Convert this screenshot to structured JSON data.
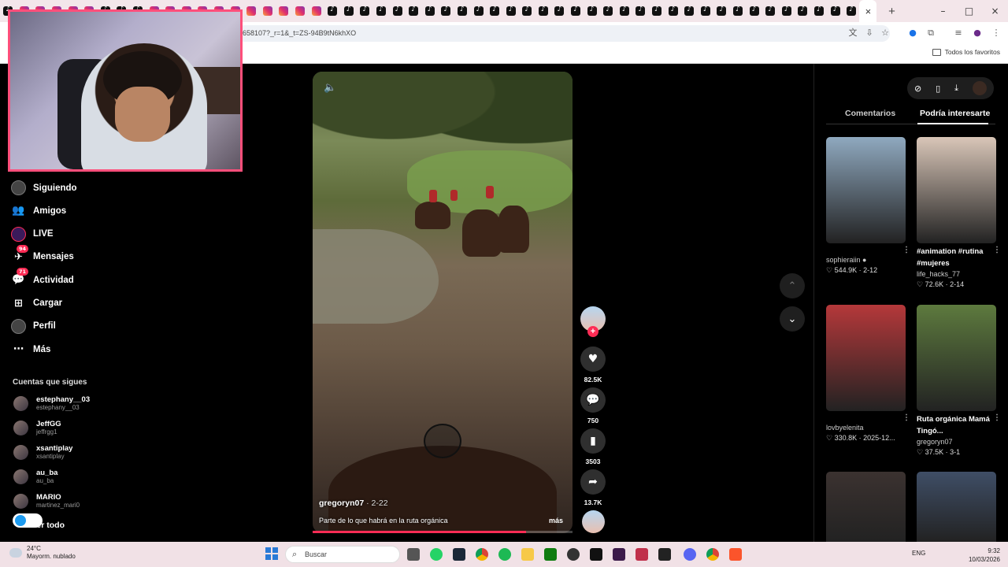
{
  "browser": {
    "url_fragment": "658107?_r=1&_t=ZS-94B9tN6khXO",
    "bookmarks_label": "Todos los favoritos",
    "new_tab": "+",
    "window_controls": [
      "–",
      "□",
      "×"
    ]
  },
  "sidebar": {
    "items": [
      {
        "label": "Siguiendo",
        "icon": "following-avatar-icon",
        "badge": ""
      },
      {
        "label": "Amigos",
        "icon": "friends-icon",
        "badge": ""
      },
      {
        "label": "LIVE",
        "icon": "live-icon",
        "badge": ""
      },
      {
        "label": "Mensajes",
        "icon": "messages-icon",
        "badge": "94"
      },
      {
        "label": "Actividad",
        "icon": "activity-icon",
        "badge": "71"
      },
      {
        "label": "Cargar",
        "icon": "upload-icon",
        "badge": ""
      },
      {
        "label": "Perfil",
        "icon": "profile-avatar-icon",
        "badge": ""
      },
      {
        "label": "Más",
        "icon": "more-icon",
        "badge": ""
      }
    ],
    "following_heading": "Cuentas que sigues",
    "accounts": [
      {
        "name": "estephany__03",
        "handle": "estephany__03"
      },
      {
        "name": "JeffGG",
        "handle": "jeffrgg1"
      },
      {
        "name": "xsantiplay",
        "handle": "xsantiplay"
      },
      {
        "name": "au_ba",
        "handle": "au_ba"
      },
      {
        "name": "MARIO",
        "handle": "martinez_mari0"
      }
    ],
    "see_all": "Ver todo"
  },
  "video": {
    "author": "gregoryn07",
    "date": " · 2-22",
    "caption": "Parte de lo que habrá en  la ruta orgánica",
    "more": "más",
    "progress": 0.82
  },
  "actions": {
    "likes": "82.5K",
    "comments": "750",
    "saves": "3503",
    "shares": "13.7K"
  },
  "right_panel": {
    "tab_comments": "Comentarios",
    "tab_suggested": "Podría interesarte",
    "cards": [
      {
        "title": "",
        "user": "sophieraiin",
        "likes": "544.9K",
        "date": "2-12",
        "color": "#8fa9bf"
      },
      {
        "title": "#animation #rutina #mujeres",
        "user": "life_hacks_77",
        "likes": "72.6K",
        "date": "2-14",
        "color": "#d9c6b8"
      },
      {
        "title": "",
        "user": "lovbyelenita",
        "likes": "330.8K",
        "date": "2025-12...",
        "color": "#b5383a"
      },
      {
        "title": "Ruta orgánica Mamá Tingó...",
        "user": "gregoryn07",
        "likes": "37.5K",
        "date": "3-1",
        "color": "#5d7a3e"
      },
      {
        "title": "",
        "user": "",
        "likes": "",
        "date": "",
        "color": "#3b3230"
      },
      {
        "title": "",
        "user": "",
        "likes": "",
        "date": "",
        "color": "#3f4e66"
      }
    ]
  },
  "taskbar": {
    "temperature": "24°C",
    "weather": "Mayorm. nublado",
    "search_placeholder": "Buscar",
    "language": "ENG",
    "time": "9:32",
    "date": "10/03/2026"
  }
}
